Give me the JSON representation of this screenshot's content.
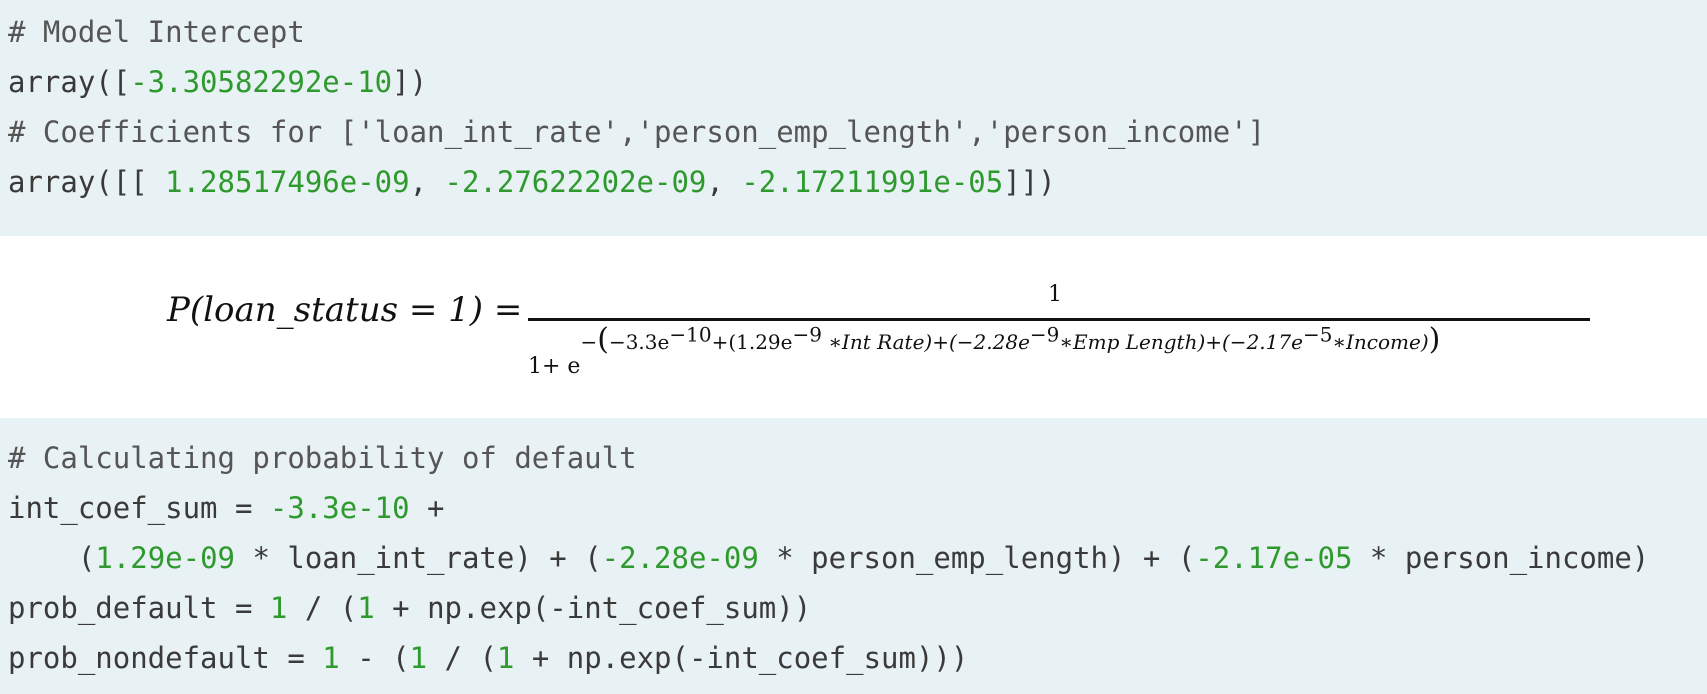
{
  "code_block_1": {
    "line1": "# Model Intercept",
    "line2_prefix": "array([",
    "line2_num": "-3.30582292e-10",
    "line2_suffix": "])",
    "line3": "# Coefficients for ['loan_int_rate','person_emp_length','person_income']",
    "line4_prefix": "array([[ ",
    "line4_num1": "1.28517496e-09",
    "line4_sep1": ", ",
    "line4_num2": "-2.27622202e-09",
    "line4_sep2": ", ",
    "line4_num3": "-2.17211991e-05",
    "line4_suffix": "]])"
  },
  "formula": {
    "lhs": "P(loan_status = 1) =",
    "numerator": "1",
    "den_base": "1+ e",
    "den_minus": "−",
    "den_t1": "−3.3e",
    "den_t1_exp": "−10",
    "den_t2a": "+(1.29e",
    "den_t2_exp": "−9",
    "den_t2b": " ∗Int Rate)+(−2.28e",
    "den_t3_exp": "−9",
    "den_t3b": "∗Emp Length)+(−2.17e",
    "den_t4_exp": "−5",
    "den_t4b": "∗Income)"
  },
  "code_block_2": {
    "line1": "# Calculating probability of default",
    "line2_prefix": "int_coef_sum = ",
    "line2_num": "-3.3e-10",
    "line2_suffix": " +",
    "line3_a": "    (",
    "line3_n1": "1.29e-09",
    "line3_b": " * loan_int_rate) + (",
    "line3_n2": "-2.28e-09",
    "line3_c": " * person_emp_length) + (",
    "line3_n3": "-2.17e-05",
    "line3_d": " * person_income)",
    "line4_a": "prob_default = ",
    "line4_n1": "1",
    "line4_b": " / (",
    "line4_n2": "1",
    "line4_c": " + np.exp(-int_coef_sum))",
    "line5_a": "prob_nondefault = ",
    "line5_n1": "1",
    "line5_b": " - (",
    "line5_n2": "1",
    "line5_c": " / (",
    "line5_n3": "1",
    "line5_d": " + np.exp(-int_coef_sum)))"
  },
  "colors": {
    "code_bg": "#e8f1f4",
    "number": "#2e9a2e",
    "text": "#3a3a3a"
  }
}
